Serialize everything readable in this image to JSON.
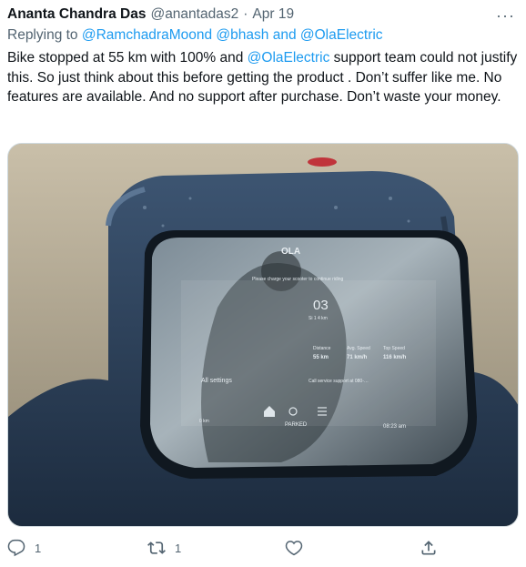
{
  "tweet": {
    "author_name": "Ananta Chandra Das",
    "author_handle": "@anantadas2",
    "date": "Apr 19",
    "more_label": "···",
    "replying_to_prefix": "Replying to",
    "replying_to": [
      "@RamchadraMoond",
      "@bhash",
      "and",
      "@OlaElectric"
    ],
    "text_parts": [
      "Bike stopped at 55 km with 100% and ",
      "@OlaElectric",
      " support team could not justify this. So just think about this before getting the product . Don’t suffer like me. No features are available. And no support after purchase. Don’t waste your money."
    ]
  },
  "media": {
    "alt": "Photo of scooter dashboard display",
    "screen": {
      "logo": "OLA",
      "message": "Please charge your scooter to continue riding",
      "big_number": "03",
      "big_number_caption": "Si 1 4 km",
      "stat_distance_label": "Distance",
      "stat_distance_value": "55 km",
      "stat_avg_label": "Avg. Speed",
      "stat_avg_value": "71 km/h",
      "stat_top_label": "Top Speed",
      "stat_top_value": "116 km/h",
      "all_settings": "All settings",
      "support": "Call service support at 080-…",
      "odo": "0 km",
      "parked": "PARKED",
      "time": "08:23 am"
    }
  },
  "actions": {
    "reply_count": "1",
    "retweet_count": "1",
    "like_count": "",
    "share_count": ""
  },
  "colors": {
    "link": "#1d9bf0",
    "secondary_text": "#536471",
    "primary_text": "#0f1419"
  }
}
